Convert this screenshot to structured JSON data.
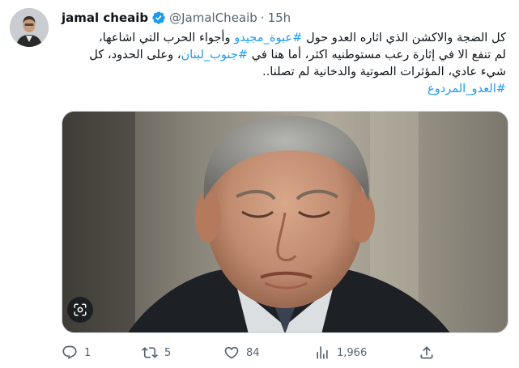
{
  "tweet": {
    "author_name": "jamal cheaib",
    "handle": "@JamalCheaib",
    "separator": "·",
    "time": "15h",
    "verified": true,
    "text": {
      "line1_a": "كل الضجة والاكشن الذي اثاره العدو حول ",
      "line1_tag": "#عبوة_مجيدو",
      "line1_b": " وأجواء الحرب التي اشاعها،",
      "line2_a": "لم تنفع الا في إثارة رعب مستوطنيه اكثر، أما هنا في ",
      "line2_tag": "#جنوب_لبنان",
      "line2_b": "، وعلى الحدود، كل",
      "line3": "شيء عادي، المؤثرات الصوتية والدخانية لم تصلنا..",
      "line4_tag": "#العدو_المردوع"
    }
  },
  "media": {
    "icon": "scan-icon"
  },
  "actions": {
    "reply": {
      "icon": "reply-icon",
      "count": "1"
    },
    "retweet": {
      "icon": "retweet-icon",
      "count": "5"
    },
    "like": {
      "icon": "heart-icon",
      "count": "84"
    },
    "views": {
      "icon": "views-chart-icon",
      "count": "1,966"
    },
    "share": {
      "icon": "share-icon"
    }
  },
  "colors": {
    "link": "#1d9bf0",
    "text": "#0f1419",
    "muted": "#536471",
    "border": "#cfd9de"
  }
}
